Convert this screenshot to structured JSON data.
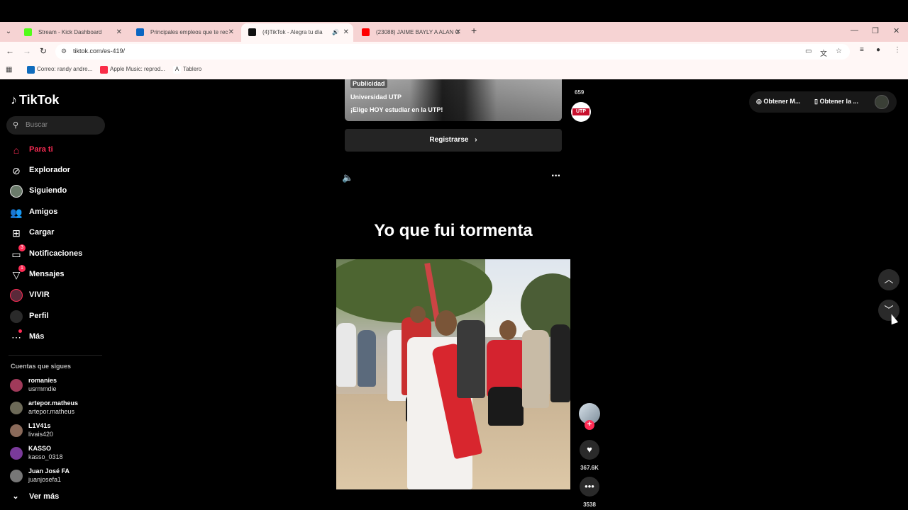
{
  "browser": {
    "tabs": [
      {
        "title": "Stream - Kick Dashboard",
        "color": "#53fc18"
      },
      {
        "title": "Principales empleos que te rec",
        "color": "#0a66c2"
      },
      {
        "title": "(4)TikTok - Alegra tu día",
        "color": "#111111"
      },
      {
        "title": "(23088) JAIME BAYLY A ALAN G",
        "color": "#ff0000"
      }
    ],
    "new_tab": "+",
    "url": "tiktok.com/es-419/",
    "bookmarks": [
      {
        "label": "Correo: randy andre...",
        "color": "#0f6cbd"
      },
      {
        "label": "Apple Music: reprod...",
        "color": "#fa2d48"
      },
      {
        "label": "Tablero",
        "color": "#ffffff"
      }
    ]
  },
  "sidebar": {
    "brand": "TikTok",
    "search_placeholder": "Buscar",
    "nav": [
      {
        "label": "Para ti",
        "icon": "home-icon"
      },
      {
        "label": "Explorador",
        "icon": "compass-icon"
      },
      {
        "label": "Siguiendo",
        "icon": "following-avatar"
      },
      {
        "label": "Amigos",
        "icon": "friends-icon"
      },
      {
        "label": "Cargar",
        "icon": "upload-icon"
      },
      {
        "label": "Notificaciones",
        "icon": "notifications-icon",
        "badge": "3"
      },
      {
        "label": "Mensajes",
        "icon": "messages-icon",
        "badge": "1"
      },
      {
        "label": "VIVIR",
        "icon": "live-icon"
      },
      {
        "label": "Perfil",
        "icon": "profile-avatar"
      },
      {
        "label": "Más",
        "icon": "more-icon"
      }
    ],
    "following_header": "Cuentas que sigues",
    "accounts": [
      {
        "name": "romanies",
        "handle": "usrmmdie"
      },
      {
        "name": "artepor.matheus",
        "handle": "artepor.matheus"
      },
      {
        "name": "L1V41s",
        "handle": "livais420"
      },
      {
        "name": "KASSO",
        "handle": "kasso_0318"
      },
      {
        "name": "Juan José FA",
        "handle": "juanjosefa1"
      }
    ],
    "see_more": "Ver más"
  },
  "ad": {
    "tag": "Publicidad",
    "brand": "Universidad UTP",
    "description": "¡Elige HOY estudiar en la UTP!",
    "cta": "Registrarse",
    "count": "659",
    "logo_text": "UTP"
  },
  "video": {
    "title": "Yo que fui tormenta",
    "likes": "367.6K",
    "comments": "3538"
  },
  "header_right": {
    "get_coins": "Obtener M...",
    "get_app": "Obtener la ..."
  }
}
